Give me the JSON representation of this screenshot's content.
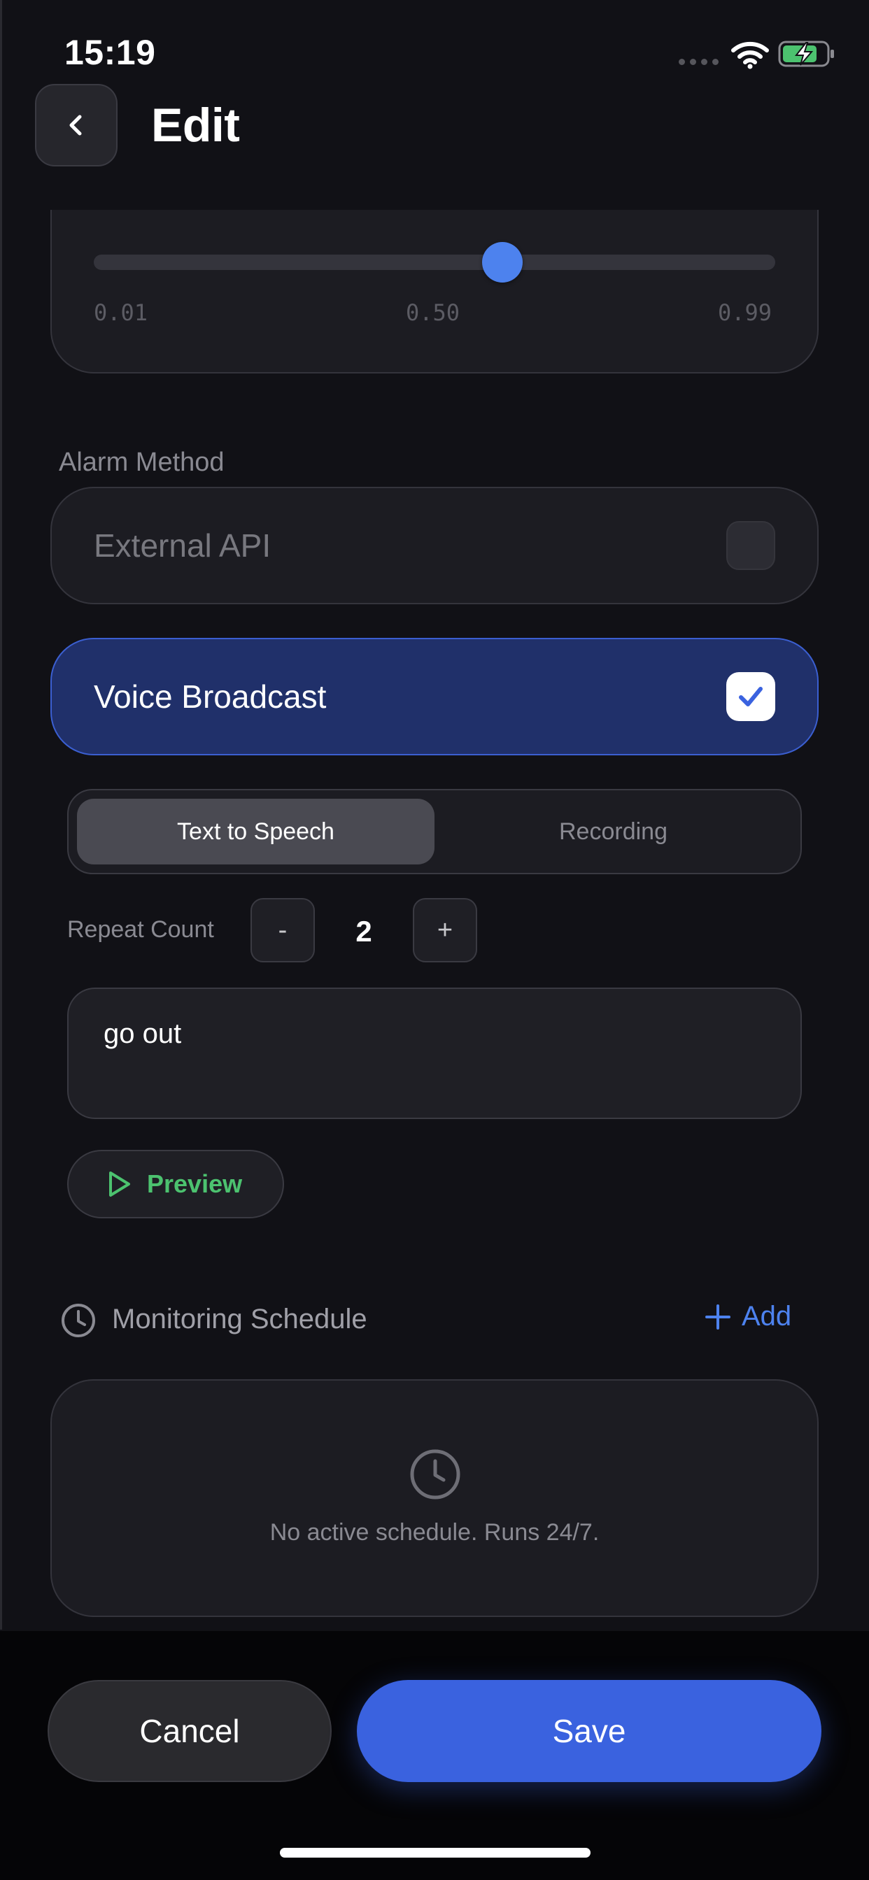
{
  "status_bar": {
    "time": "15:19"
  },
  "header": {
    "title": "Edit"
  },
  "threshold_slider": {
    "value": 0.6,
    "min_label": "0.01",
    "mid_label": "0.50",
    "max_label": "0.99"
  },
  "alarm_method": {
    "section_label": "Alarm Method",
    "options": [
      {
        "label": "External API",
        "checked": false
      },
      {
        "label": "Voice Broadcast",
        "checked": true
      }
    ]
  },
  "voice_mode": {
    "tabs": [
      {
        "label": "Text to Speech",
        "active": true
      },
      {
        "label": "Recording",
        "active": false
      }
    ]
  },
  "repeat": {
    "label": "Repeat Count",
    "decrement": "-",
    "value": "2",
    "increment": "+"
  },
  "message": {
    "value": "go out"
  },
  "preview": {
    "label": "Preview"
  },
  "schedule": {
    "title": "Monitoring Schedule",
    "add_label": "Add",
    "empty_text": "No active schedule. Runs 24/7."
  },
  "footer": {
    "cancel_label": "Cancel",
    "save_label": "Save"
  },
  "colors": {
    "accent": "#3a62df",
    "slider_thumb": "#4d82ee",
    "selected_option_bg": "#20306a",
    "preview_green": "#4cc26f",
    "battery_green": "#4cc26f"
  }
}
